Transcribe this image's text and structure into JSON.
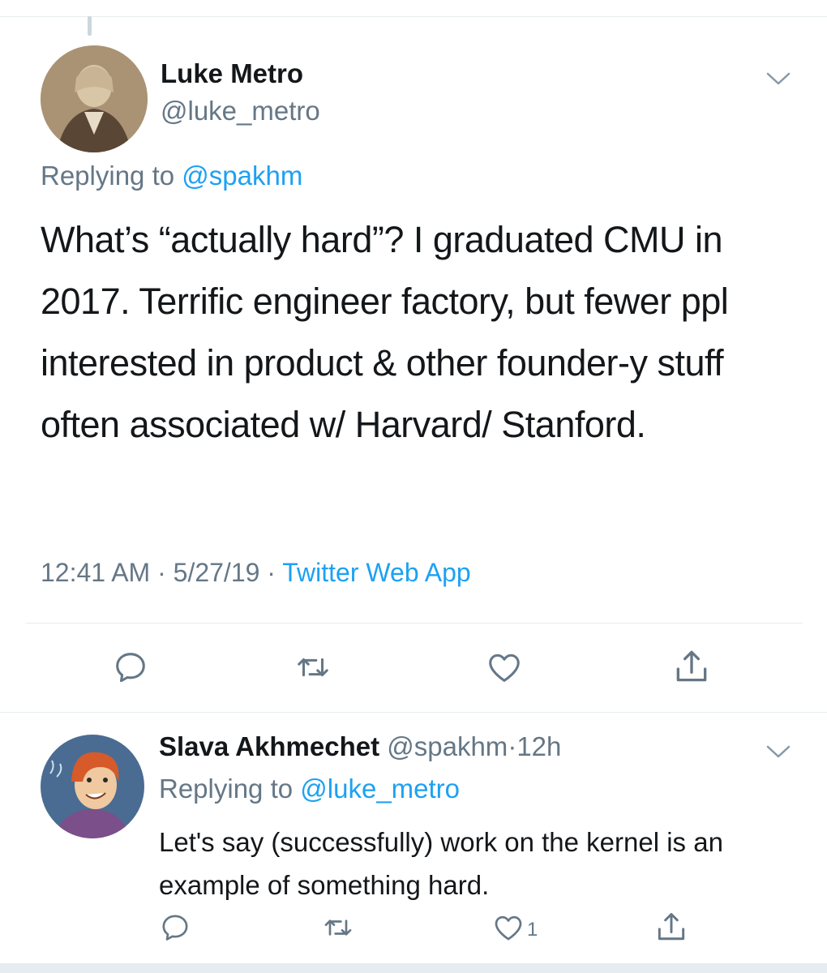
{
  "tweet": {
    "author_name": "Luke Metro",
    "author_handle": "@luke_metro",
    "replying_prefix": "Replying to",
    "replying_handle": "@spakhm",
    "text": "What’s “actually hard”? I graduated CMU in 2017. Terrific engineer factory, but fewer ppl interested in product & other founder-y stuff often associated w/ Harvard/ Stanford.",
    "time": "12:41 AM",
    "date": "5/27/19",
    "separator": "·",
    "source": "Twitter Web App",
    "actions": [
      "reply-icon",
      "retweet-icon",
      "like-icon",
      "share-icon"
    ]
  },
  "reply": {
    "author_name": "Slava Akhmechet",
    "author_handle": "@spakhm",
    "separator": "·",
    "age": "12h",
    "replying_prefix": "Replying to",
    "replying_handle": "@luke_metro",
    "text": "Let's say (successfully) work on the kernel is an example of something hard.",
    "like_count": "1",
    "actions": [
      "reply-icon",
      "retweet-icon",
      "like-icon",
      "share-icon"
    ]
  },
  "colors": {
    "link": "#1da1f2",
    "secondary_text": "#657786",
    "icon": "#657786",
    "divider": "#e6ecf0"
  }
}
